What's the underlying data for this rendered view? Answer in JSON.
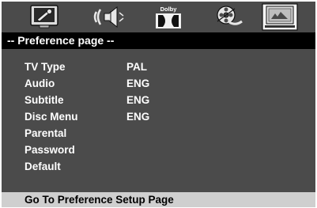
{
  "tab_icons": [
    {
      "name": "general-setup-icon"
    },
    {
      "name": "audio-setup-icon"
    },
    {
      "name": "dolby-digital-setup-icon"
    },
    {
      "name": "video-setup-icon"
    },
    {
      "name": "preference-setup-icon"
    }
  ],
  "dolby_label": "Dolby",
  "header": {
    "title": "-- Preference page --"
  },
  "menu": {
    "items": [
      {
        "label": "TV Type",
        "value": "PAL"
      },
      {
        "label": "Audio",
        "value": "ENG"
      },
      {
        "label": "Subtitle",
        "value": "ENG"
      },
      {
        "label": "Disc Menu",
        "value": "ENG"
      },
      {
        "label": "Parental",
        "value": ""
      },
      {
        "label": "Password",
        "value": ""
      },
      {
        "label": "Default",
        "value": ""
      }
    ]
  },
  "footer": {
    "text": "Go To Preference Setup Page"
  },
  "colors": {
    "panel_bg": "#4b4b4b",
    "header_bg": "#000000",
    "footer_bg": "#cfcfcf",
    "text": "#ffffff"
  }
}
